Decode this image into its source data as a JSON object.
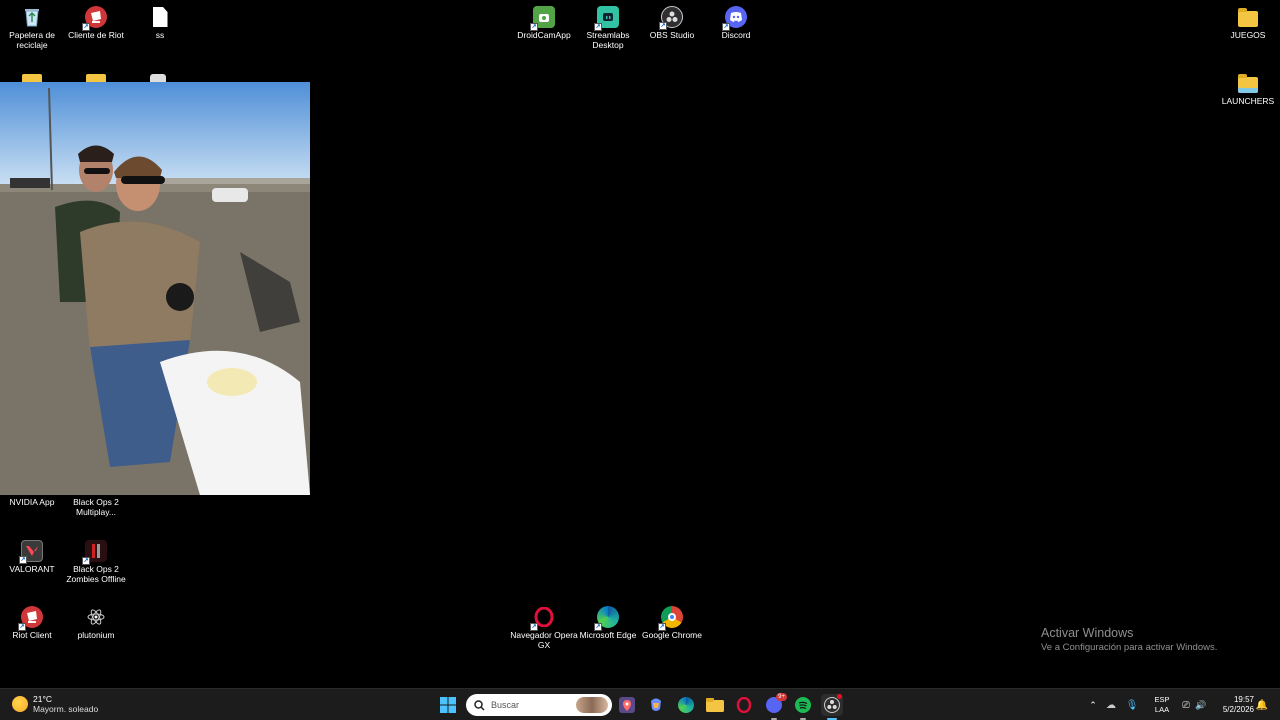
{
  "desktop": {
    "icons": {
      "recycle": "Papelera de reciclaje",
      "riot_client_es": "Cliente de Riot",
      "ss": "ss",
      "droidcam": "DroidCamApp",
      "streamlabs": "Streamlabs Desktop",
      "obs": "OBS Studio",
      "discord": "Discord",
      "juegos": "JUEGOS",
      "launchers": "LAUNCHERS",
      "nvidia": "NVIDIA App",
      "bo2_multi": "Black Ops 2 Multiplay...",
      "valorant": "VALORANT",
      "bo2_zombies": "Black Ops 2 Zombies Offline",
      "riot_client": "Riot Client",
      "plutonium": "plutonium",
      "opera": "Navegador Opera GX",
      "edge": "Microsoft Edge",
      "chrome": "Google Chrome"
    }
  },
  "watermark": {
    "title": "Activar Windows",
    "subtitle": "Ve a Configuración para activar Windows."
  },
  "taskbar": {
    "weather_temp": "21°C",
    "weather_desc": "Mayorm. soleado",
    "search_placeholder": "Buscar",
    "lang_1": "ESP",
    "lang_2": "LAA",
    "time": "19:57",
    "date": "5/2/2026",
    "discord_badge": "9+"
  },
  "colors": {
    "accent": "#0078d4",
    "taskbar_bg": "#1c1c1c",
    "riot_red": "#d13639",
    "discord": "#5865f2"
  }
}
